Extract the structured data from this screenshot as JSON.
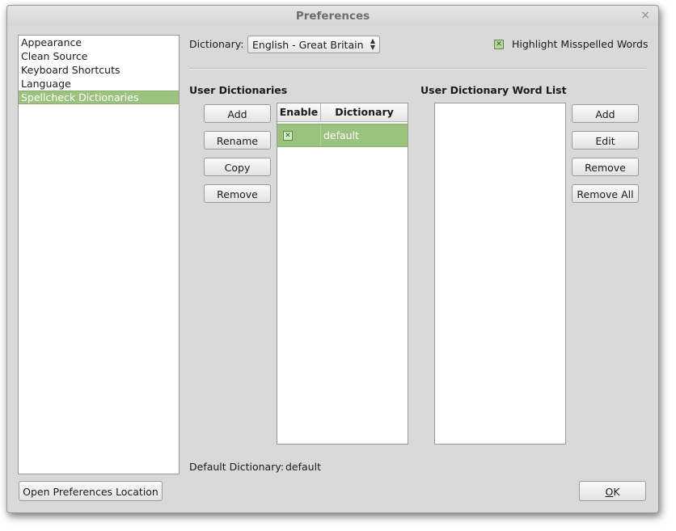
{
  "window": {
    "title": "Preferences",
    "close_glyph": "×"
  },
  "categories": {
    "items": [
      "Appearance",
      "Clean Source",
      "Keyboard Shortcuts",
      "Language",
      "Spellcheck Dictionaries"
    ],
    "selected": "Spellcheck Dictionaries"
  },
  "dictionary": {
    "label": "Dictionary:",
    "value": "English - Great Britain"
  },
  "highlight": {
    "label": "Highlight Misspelled Words",
    "checked": true
  },
  "user_dictionaries": {
    "heading": "User Dictionaries",
    "buttons": {
      "add": "Add",
      "rename": "Rename",
      "copy": "Copy",
      "remove": "Remove"
    },
    "columns": {
      "enable": "Enable",
      "dictionary": "Dictionary"
    },
    "rows": [
      {
        "enabled": true,
        "name": "default"
      }
    ]
  },
  "word_list": {
    "heading": "User Dictionary Word List",
    "buttons": {
      "add": "Add",
      "edit": "Edit",
      "remove": "Remove",
      "remove_all": "Remove All"
    }
  },
  "default_dictionary": {
    "label": "Default Dictionary:",
    "value": "default"
  },
  "footer": {
    "open_location": "Open Preferences Location",
    "ok": "OK",
    "ok_mnemonic": "O",
    "ok_rest": "K"
  },
  "colors": {
    "selection": "#9bc37f",
    "window_bg": "#d9d9d9"
  }
}
